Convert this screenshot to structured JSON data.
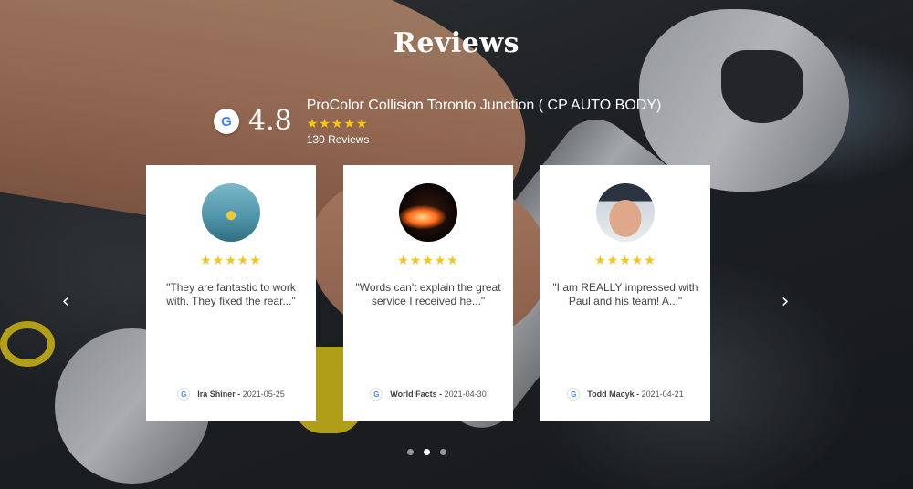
{
  "page": {
    "title": "Reviews"
  },
  "summary": {
    "google_icon": "G",
    "rating": "4.8",
    "business_name": "ProColor Collision Toronto Junction ( CP AUTO BODY)",
    "stars": "★★★★★",
    "review_count": "130 Reviews"
  },
  "reviews": [
    {
      "stars": "★★★★★",
      "text": "\"They are fantastic to work with. They fixed the rear...\"",
      "author": "Ira Shiner -",
      "date": "2021-05-25",
      "google_icon": "G"
    },
    {
      "stars": "★★★★★",
      "text": "\"Words can't explain the great service I received he...\"",
      "author": "World Facts -",
      "date": "2021-04-30",
      "google_icon": "G"
    },
    {
      "stars": "★★★★★",
      "text": "\"I am REALLY impressed with Paul and his team! A...\"",
      "author": "Todd Macyk -",
      "date": "2021-04-21",
      "google_icon": "G"
    }
  ],
  "navigation": {
    "prev_icon": "‹",
    "next_icon": "›",
    "dot_count": 3,
    "active_dot": 2
  },
  "colors": {
    "star": "#f5c518",
    "card_bg": "#ffffff",
    "google_blue": "#4285f4"
  }
}
